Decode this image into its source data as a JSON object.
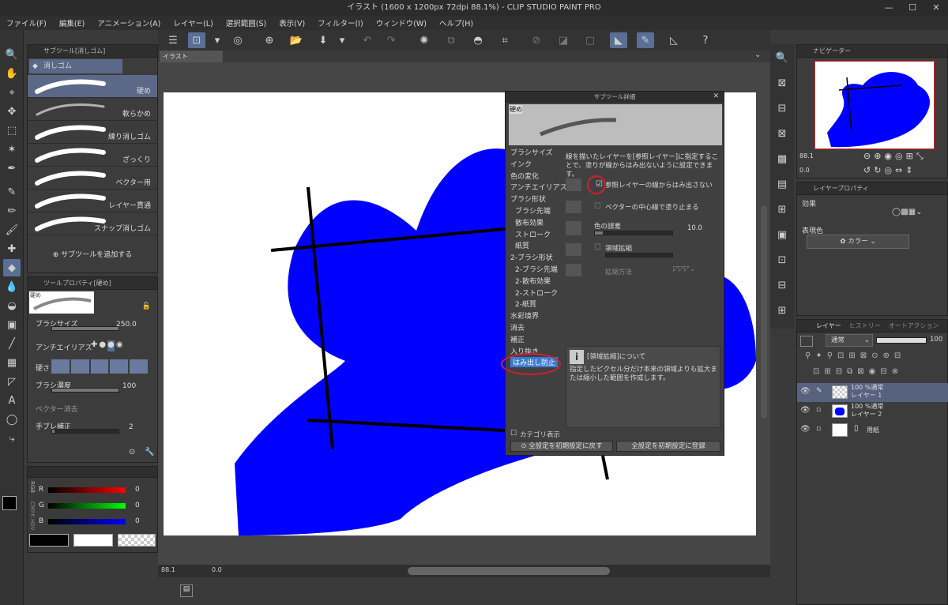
{
  "window": {
    "title": "イラスト (1600 x 1200px 72dpi 88.1%)  - CLIP STUDIO PAINT PRO",
    "minimize": "—",
    "maximize": "☐",
    "close": "✕"
  },
  "menu": [
    "ファイル(F)",
    "編集(E)",
    "アニメーション(A)",
    "レイヤー(L)",
    "選択範囲(S)",
    "表示(V)",
    "フィルター(I)",
    "ウィンドウ(W)",
    "ヘルプ(H)"
  ],
  "doc_tab": "イラスト",
  "subtool_panel": {
    "title": "サブツール[消しゴム]",
    "group": "消しゴム",
    "items": [
      "硬め",
      "軟らかめ",
      "練り消しゴム",
      "ざっくり",
      "ベクター用",
      "レイヤー貫通",
      "スナップ消しゴム"
    ],
    "add_button": "サブツールを追加する"
  },
  "tool_property": {
    "title": "ツールプロパティ[硬め]",
    "preview_label": "硬め",
    "brush_size_label": "ブラシサイズ",
    "brush_size_value": "250.0",
    "antialias_label": "アンチエイリアス",
    "hardness_label": "硬さ",
    "density_label": "ブラシ濃度",
    "density_value": "100",
    "vector_erase_label": "ベクター消去",
    "stabilizer_label": "手ブレ補正",
    "stabilizer_value": "2"
  },
  "color_panel": {
    "r_label": "R",
    "g_label": "G",
    "b_label": "B",
    "r_value": "0",
    "g_value": "0",
    "b_value": "0",
    "mode_label": "RGB",
    "side_label": "CMYK HSV"
  },
  "status": {
    "zoom": "88.1",
    "angle": "0.0"
  },
  "subtool_detail": {
    "title": "サブツール詳細",
    "preview_label": "硬め",
    "categories": [
      {
        "label": "ブラシサイズ",
        "sub": false
      },
      {
        "label": "インク",
        "sub": false
      },
      {
        "label": "色の変化",
        "sub": false
      },
      {
        "label": "アンチエイリアス",
        "sub": false
      },
      {
        "label": "ブラシ形状",
        "sub": false
      },
      {
        "label": "ブラシ先端",
        "sub": true
      },
      {
        "label": "散布効果",
        "sub": true
      },
      {
        "label": "ストローク",
        "sub": true
      },
      {
        "label": "紙質",
        "sub": true
      },
      {
        "label": "2-ブラシ形状",
        "sub": false
      },
      {
        "label": "2-ブラシ先端",
        "sub": true
      },
      {
        "label": "2-散布効果",
        "sub": true
      },
      {
        "label": "2-ストローク",
        "sub": true
      },
      {
        "label": "2-紙質",
        "sub": true
      },
      {
        "label": "水彩境界",
        "sub": false
      },
      {
        "label": "消去",
        "sub": false
      },
      {
        "label": "補正",
        "sub": false
      },
      {
        "label": "入り抜き",
        "sub": false
      },
      {
        "label": "はみ出し防止",
        "sub": false
      }
    ],
    "description": "線を描いたレイヤーを[参照レイヤー]に指定することで、塗りが線からはみ出ないように設定できます。",
    "opt_ref_layer": "参照レイヤーの線からはみ出さない",
    "opt_vector_center": "ベクターの中心線で塗り止まる",
    "color_tolerance_label": "色の誤差",
    "color_tolerance_value": "10.0",
    "area_scale_label": "領域拡縮",
    "scale_method_label": "拡縮方法",
    "info_title": "[領域拡縮]について",
    "info_body": "指定したピクセル分だけ本来の領域よりも拡大または縮小した範囲を作成します。",
    "category_display": "カテゴリ表示",
    "reset_all": "全設定を初期設定に戻す",
    "save_all": "全設定を初期設定に登録"
  },
  "navigator": {
    "title": "ナビゲーター",
    "zoom": "88.1",
    "angle": "0.0"
  },
  "layer_property": {
    "title": "レイヤープロパティ",
    "effect_label": "効果",
    "expression_label": "表現色",
    "expression_value": "カラー"
  },
  "layer_panel": {
    "tabs": [
      "レイヤー",
      "ヒストリー",
      "オートアクション"
    ],
    "blend_mode": "通常",
    "opacity": "100",
    "layers": [
      {
        "line1": "100 %通常",
        "line2": "レイヤー 1",
        "selected": true
      },
      {
        "line1": "100 %通常",
        "line2": "レイヤー 2",
        "selected": false
      },
      {
        "line1": "",
        "line2": "用紙",
        "selected": false
      }
    ]
  },
  "colors": {
    "accent": "#5a6f95",
    "highlight_ring": "#d61f2a",
    "shape_fill": "#0000ff",
    "selected_category": "#3b7bd3"
  }
}
